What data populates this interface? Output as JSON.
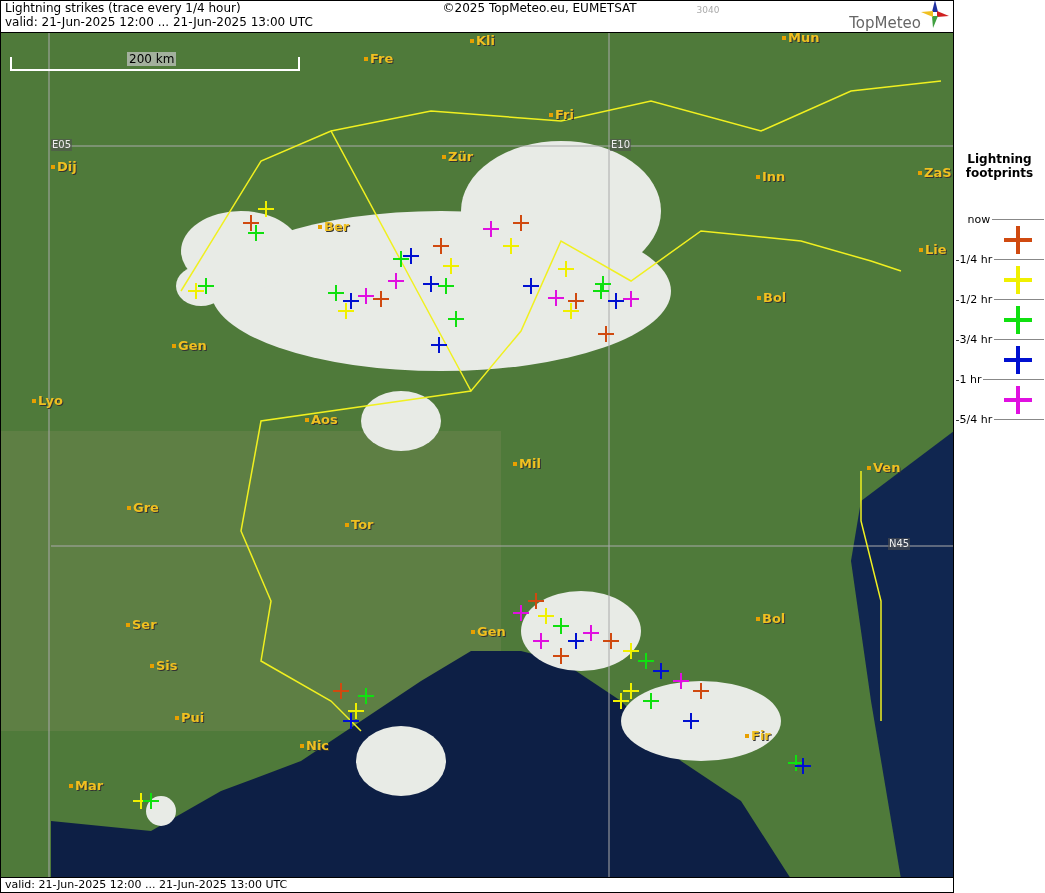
{
  "header": {
    "title": "Lightning strikes (trace every 1/4 hour)",
    "copyright": "©2025 TopMeteo.eu, EUMETSAT",
    "code": "3040",
    "valid": "valid:  21-Jun-2025 12:00 ... 21-Jun-2025 13:00 UTC",
    "logo_text": "TopMeteo"
  },
  "map": {
    "scale_label": "200 km",
    "grid_labels": [
      "E05",
      "E10",
      "N45"
    ],
    "cities": [
      {
        "name": "Kli"
      },
      {
        "name": "Mun"
      },
      {
        "name": "Fre"
      },
      {
        "name": "Fri"
      },
      {
        "name": "Zür"
      },
      {
        "name": "Dij"
      },
      {
        "name": "Inn"
      },
      {
        "name": "ZaS"
      },
      {
        "name": "Ber"
      },
      {
        "name": "Lie"
      },
      {
        "name": "Bol"
      },
      {
        "name": "Gen"
      },
      {
        "name": "Lyo"
      },
      {
        "name": "Aos"
      },
      {
        "name": "Mil"
      },
      {
        "name": "Ven"
      },
      {
        "name": "Gre"
      },
      {
        "name": "Tor"
      },
      {
        "name": "Ser"
      },
      {
        "name": "Bol"
      },
      {
        "name": "Gen"
      },
      {
        "name": "Sis"
      },
      {
        "name": "Pui"
      },
      {
        "name": "Nic"
      },
      {
        "name": "Fir"
      },
      {
        "name": "Mar"
      }
    ]
  },
  "legend": {
    "title": "Lightning footprints",
    "ticks": [
      "now",
      "-1/4 hr",
      "-1/2 hr",
      "-3/4 hr",
      "-1 hr",
      "-5/4 hr"
    ],
    "crosses": [
      {
        "color": "#d04a10"
      },
      {
        "color": "#f0f000"
      },
      {
        "color": "#10e010"
      },
      {
        "color": "#0010d0"
      },
      {
        "color": "#e010e0"
      }
    ]
  },
  "footer": {
    "valid": "valid:  21-Jun-2025 12:00 ... 21-Jun-2025 13:00 UTC"
  }
}
